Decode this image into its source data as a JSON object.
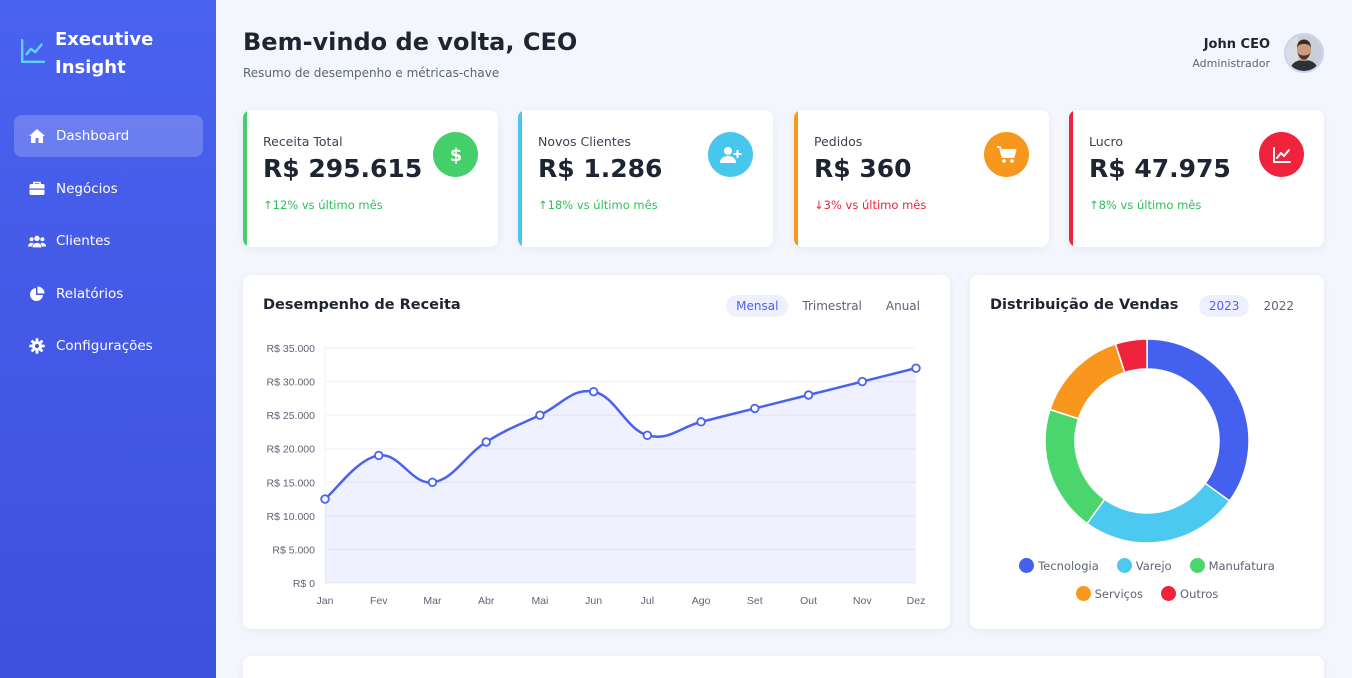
{
  "brand": {
    "name": "Executive Insight",
    "icon": "chart-line-icon"
  },
  "nav": [
    {
      "label": "Dashboard",
      "icon": "home-icon",
      "active": true
    },
    {
      "label": "Negócios",
      "icon": "briefcase-icon",
      "active": false
    },
    {
      "label": "Clientes",
      "icon": "users-icon",
      "active": false
    },
    {
      "label": "Relatórios",
      "icon": "pie-chart-icon",
      "active": false
    },
    {
      "label": "Configurações",
      "icon": "gear-icon",
      "active": false
    }
  ],
  "header": {
    "title": "Bem-vindo de volta, CEO",
    "subtitle": "Resumo de desempenho e métricas-chave"
  },
  "user": {
    "name": "John CEO",
    "role": "Administrador"
  },
  "kpis": [
    {
      "label": "Receita Total",
      "value": "R$ 295.615",
      "change": "12% vs último mês",
      "direction": "up",
      "color": "#45cf6a",
      "icon": "dollar-icon"
    },
    {
      "label": "Novos Clientes",
      "value": "R$ 1.286",
      "change": "18% vs último mês",
      "direction": "up",
      "color": "#48c7ec",
      "icon": "user-plus-icon"
    },
    {
      "label": "Pedidos",
      "value": "R$ 360",
      "change": "3% vs último mês",
      "direction": "down",
      "color": "#f7971e",
      "icon": "cart-icon"
    },
    {
      "label": "Lucro",
      "value": "R$ 47.975",
      "change": "8% vs último mês",
      "direction": "up",
      "color": "#ef233c",
      "icon": "chart-line-icon"
    }
  ],
  "revenue_panel": {
    "title": "Desempenho de Receita",
    "tabs": [
      "Mensal",
      "Trimestral",
      "Anual"
    ],
    "active_tab": "Mensal"
  },
  "sales_panel": {
    "title": "Distribuição de Vendas",
    "tabs": [
      "2023",
      "2022"
    ],
    "active_tab": "2023"
  },
  "colors": {
    "accent": "#4a62f0",
    "up": "#2dbf5a",
    "down": "#ef233c"
  },
  "chart_data": [
    {
      "type": "line",
      "title": "Desempenho de Receita",
      "categories": [
        "Jan",
        "Fev",
        "Mar",
        "Abr",
        "Mai",
        "Jun",
        "Jul",
        "Ago",
        "Set",
        "Out",
        "Nov",
        "Dez"
      ],
      "values": [
        12500,
        19000,
        15000,
        21000,
        25000,
        28500,
        22000,
        24000,
        26000,
        28000,
        30000,
        32000
      ],
      "ylim": [
        0,
        35000
      ],
      "yticks": [
        0,
        5000,
        10000,
        15000,
        20000,
        25000,
        30000,
        35000
      ],
      "ytick_labels": [
        "R$ 0",
        "R$ 5.000",
        "R$ 10.000",
        "R$ 15.000",
        "R$ 20.000",
        "R$ 25.000",
        "R$ 30.000",
        "R$ 35.000"
      ],
      "grid": true,
      "area_fill": true,
      "color": "#4a62f0"
    },
    {
      "type": "pie",
      "title": "Distribuição de Vendas",
      "donut": true,
      "categories": [
        "Tecnologia",
        "Varejo",
        "Manufatura",
        "Serviços",
        "Outros"
      ],
      "values": [
        35,
        25,
        20,
        15,
        5
      ],
      "colors": [
        "#4361ee",
        "#4cc9f0",
        "#4ad66d",
        "#f8961e",
        "#ef233c"
      ],
      "legend": "bottom"
    }
  ]
}
